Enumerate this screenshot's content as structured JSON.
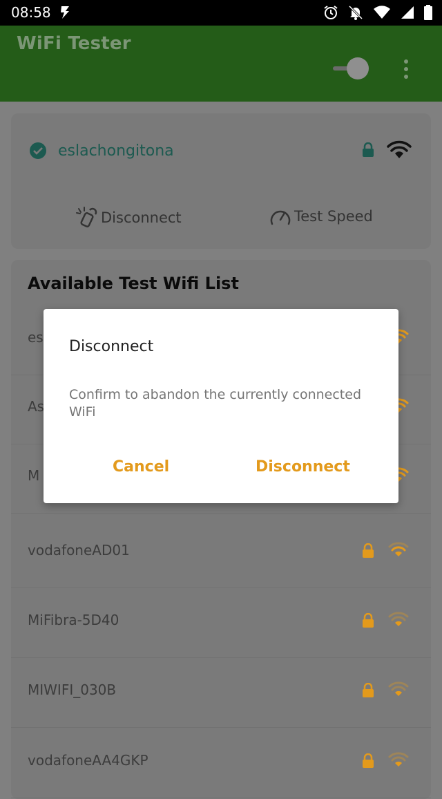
{
  "status_bar": {
    "time": "08:58",
    "icons": [
      "bolt-icon",
      "alarm-icon",
      "notifications-off-icon",
      "wifi-icon",
      "signal-icon",
      "battery-icon"
    ]
  },
  "app_bar": {
    "title": "WiFi Tester",
    "toggle_state": "off"
  },
  "connected_network": {
    "ssid": "eslachongitona",
    "status": "connected",
    "secured": true,
    "actions": {
      "disconnect_label": "Disconnect",
      "test_speed_label": "Test Speed"
    }
  },
  "available_list": {
    "title": "Available Test Wifi List",
    "items": [
      {
        "ssid": "es",
        "secured": true,
        "signal": 3
      },
      {
        "ssid": "As",
        "secured": true,
        "signal": 3
      },
      {
        "ssid": "M",
        "secured": true,
        "signal": 3
      },
      {
        "ssid": "vodafoneAD01",
        "secured": true,
        "signal": 2
      },
      {
        "ssid": "MiFibra-5D40",
        "secured": true,
        "signal": 1
      },
      {
        "ssid": "MIWIFI_030B",
        "secured": true,
        "signal": 1
      },
      {
        "ssid": "vodafoneAA4GKP",
        "secured": true,
        "signal": 1
      }
    ]
  },
  "dialog": {
    "title": "Disconnect",
    "message": "Confirm to abandon the currently connected WiFi",
    "cancel_label": "Cancel",
    "confirm_label": "Disconnect"
  },
  "colors": {
    "app_bar": "#245c18",
    "accent_orange": "#e39a1c",
    "connected_teal": "#1c5a50",
    "scrim_gray": "#808080"
  }
}
